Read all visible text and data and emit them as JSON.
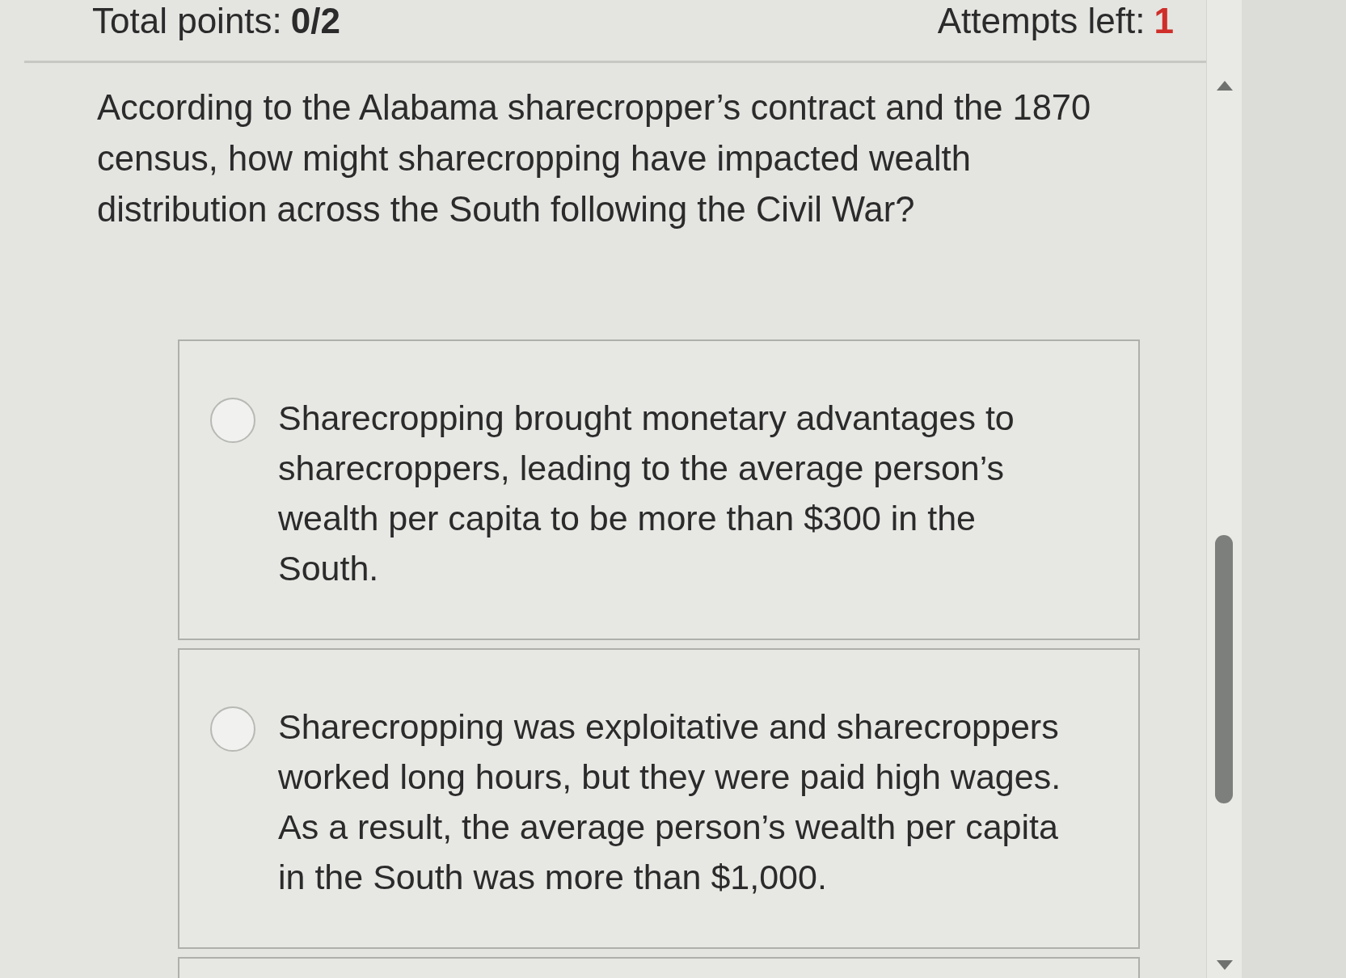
{
  "header": {
    "points_label": "Total points:",
    "points_value": "0/2",
    "attempts_label": "Attempts left:",
    "attempts_value": "1"
  },
  "question": {
    "text": "According to the Alabama sharecropper’s contract and the 1870 census, how might sharecropping have impacted wealth distribution across the South following the Civil War?"
  },
  "options": [
    {
      "text": "Sharecropping brought monetary advantages to sharecroppers, leading to the average person’s wealth per capita to be more than $300 in the South.",
      "selected": false
    },
    {
      "text": "Sharecropping was exploitative and sharecroppers worked long hours, but they were paid high wages. As a result, the average person’s wealth per capita in the South was more than $1,000.",
      "selected": false
    }
  ],
  "more_options_below": true
}
